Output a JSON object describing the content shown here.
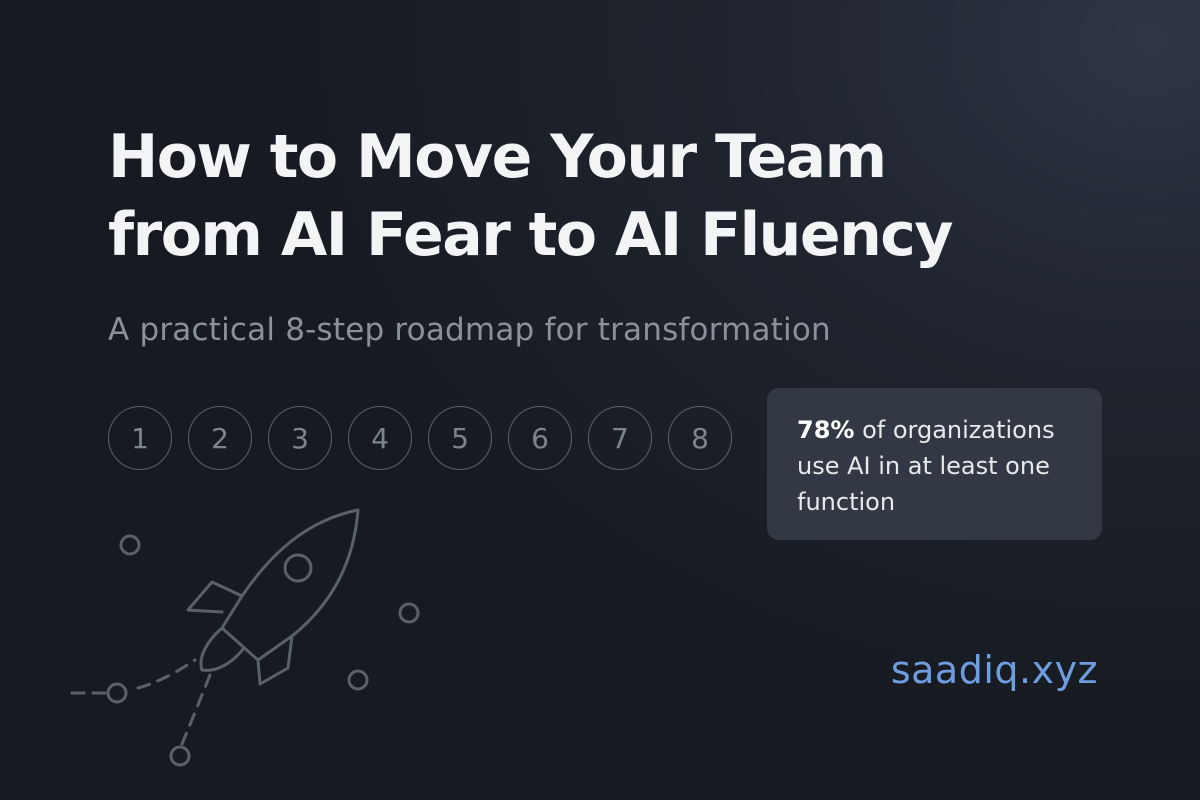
{
  "title": {
    "line1": "How to Move Your Team",
    "line2": "from AI Fear to AI Fluency"
  },
  "subtitle": "A practical 8-step roadmap for transformation",
  "steps": [
    "1",
    "2",
    "3",
    "4",
    "5",
    "6",
    "7",
    "8"
  ],
  "stat": {
    "value": "78%",
    "text": " of organizations use AI in at least one function"
  },
  "brand": "saadiq.xyz",
  "colors": {
    "background": "#1c2028",
    "title": "#f3f4f6",
    "subtitle": "#8b919b",
    "step_outline": "#5b616b",
    "card": "#323944",
    "brand": "#6f9ee0",
    "illustration": "#5a606a"
  },
  "icons": {
    "illustration": "rocket-icon"
  }
}
